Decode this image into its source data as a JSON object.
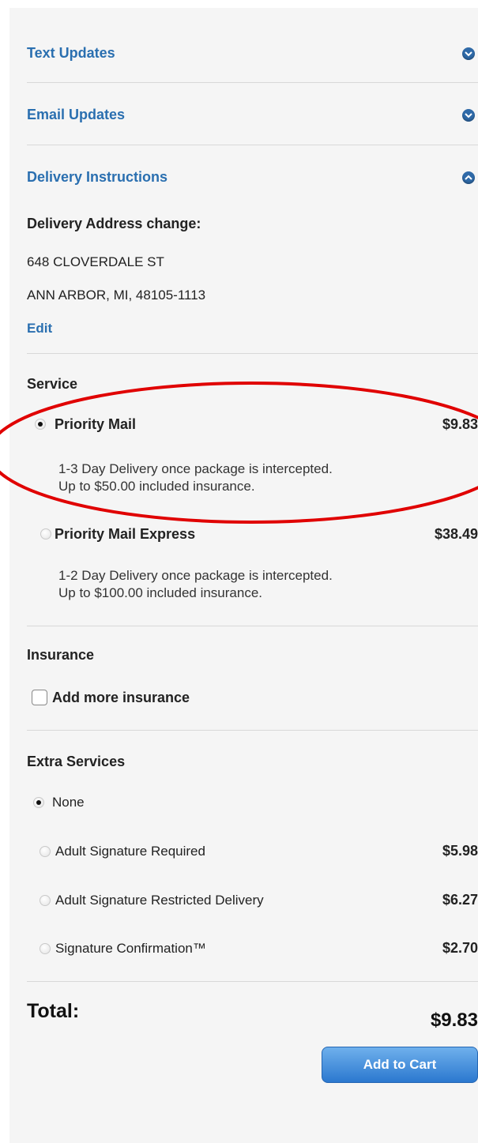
{
  "accordions": {
    "text_updates": "Text Updates",
    "email_updates": "Email Updates",
    "delivery_instructions": "Delivery Instructions"
  },
  "delivery": {
    "address_heading": "Delivery Address change:",
    "address_line1": "648 CLOVERDALE ST",
    "address_line2": "ANN ARBOR, MI, 48105-1113",
    "edit_label": "Edit"
  },
  "service": {
    "heading": "Service",
    "options": [
      {
        "label": "Priority Mail",
        "price": "$9.83",
        "selected": true,
        "desc_line1": "1-3 Day Delivery once package is intercepted.",
        "desc_line2": "Up to $50.00 included insurance."
      },
      {
        "label": "Priority Mail Express",
        "price": "$38.49",
        "selected": false,
        "desc_line1": "1-2 Day Delivery once package is intercepted.",
        "desc_line2": "Up to $100.00 included insurance."
      }
    ]
  },
  "insurance": {
    "heading": "Insurance",
    "add_more_label": "Add more insurance"
  },
  "extra_services": {
    "heading": "Extra Services",
    "options": [
      {
        "label": "None",
        "price": "",
        "selected": true
      },
      {
        "label": "Adult Signature Required",
        "price": "$5.98",
        "selected": false
      },
      {
        "label": "Adult Signature Restricted Delivery",
        "price": "$6.27",
        "selected": false
      },
      {
        "label": "Signature Confirmation™",
        "price": "$2.70",
        "selected": false
      }
    ]
  },
  "total": {
    "label": "Total:",
    "value": "$9.83"
  },
  "cart": {
    "add_label": "Add to Cart"
  },
  "colors": {
    "link_blue": "#2a6fb0",
    "button_blue": "#2b78cf",
    "highlight_red": "#e00000"
  }
}
